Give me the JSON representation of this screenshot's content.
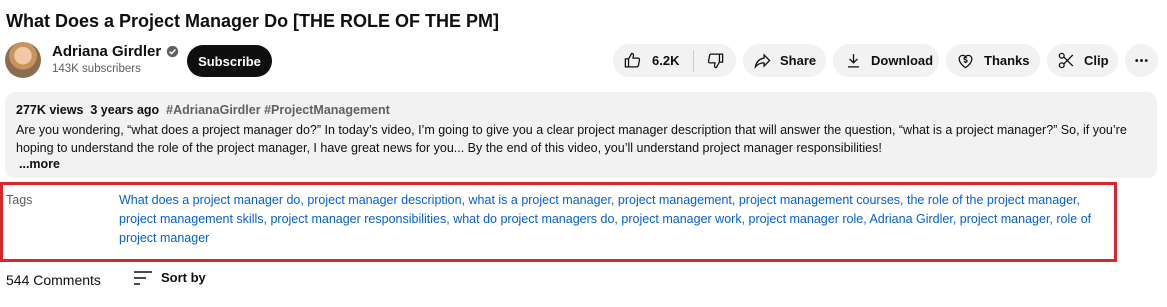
{
  "video": {
    "title": "What Does a Project Manager Do [THE ROLE OF THE PM]"
  },
  "channel": {
    "name": "Adriana Girdler",
    "subscribers": "143K subscribers",
    "subscribe_label": "Subscribe"
  },
  "actions": {
    "like_count": "6.2K",
    "share_label": "Share",
    "download_label": "Download",
    "thanks_label": "Thanks",
    "clip_label": "Clip"
  },
  "description": {
    "views": "277K views",
    "age": "3 years ago",
    "hashtags": "#AdrianaGirdler #ProjectManagement",
    "text": "Are you wondering, “what does a project manager do?” In today’s video, I’m going to give you a clear project manager description that will answer the question, “what is a project manager?” So, if you’re hoping to understand the role of the project manager, I have great news for you... By the end of this video, you’ll understand project manager responsibilities!",
    "more_label": "...more"
  },
  "tags": {
    "label": "Tags",
    "items": [
      "What does a project manager do",
      "project manager description",
      "what is a project manager",
      "project management",
      "project management courses",
      "the role of the project manager",
      "project management skills",
      "project manager responsibilities",
      "what do project managers do",
      "project manager work",
      "project manager role",
      "Adriana Girdler",
      "project manager",
      "role of project manager"
    ]
  },
  "comments": {
    "count_label": "544 Comments",
    "sort_label": "Sort by"
  },
  "colors": {
    "tag_link": "#065fd4",
    "highlight_border": "#d9252c",
    "pill_bg": "#f2f2f2"
  }
}
